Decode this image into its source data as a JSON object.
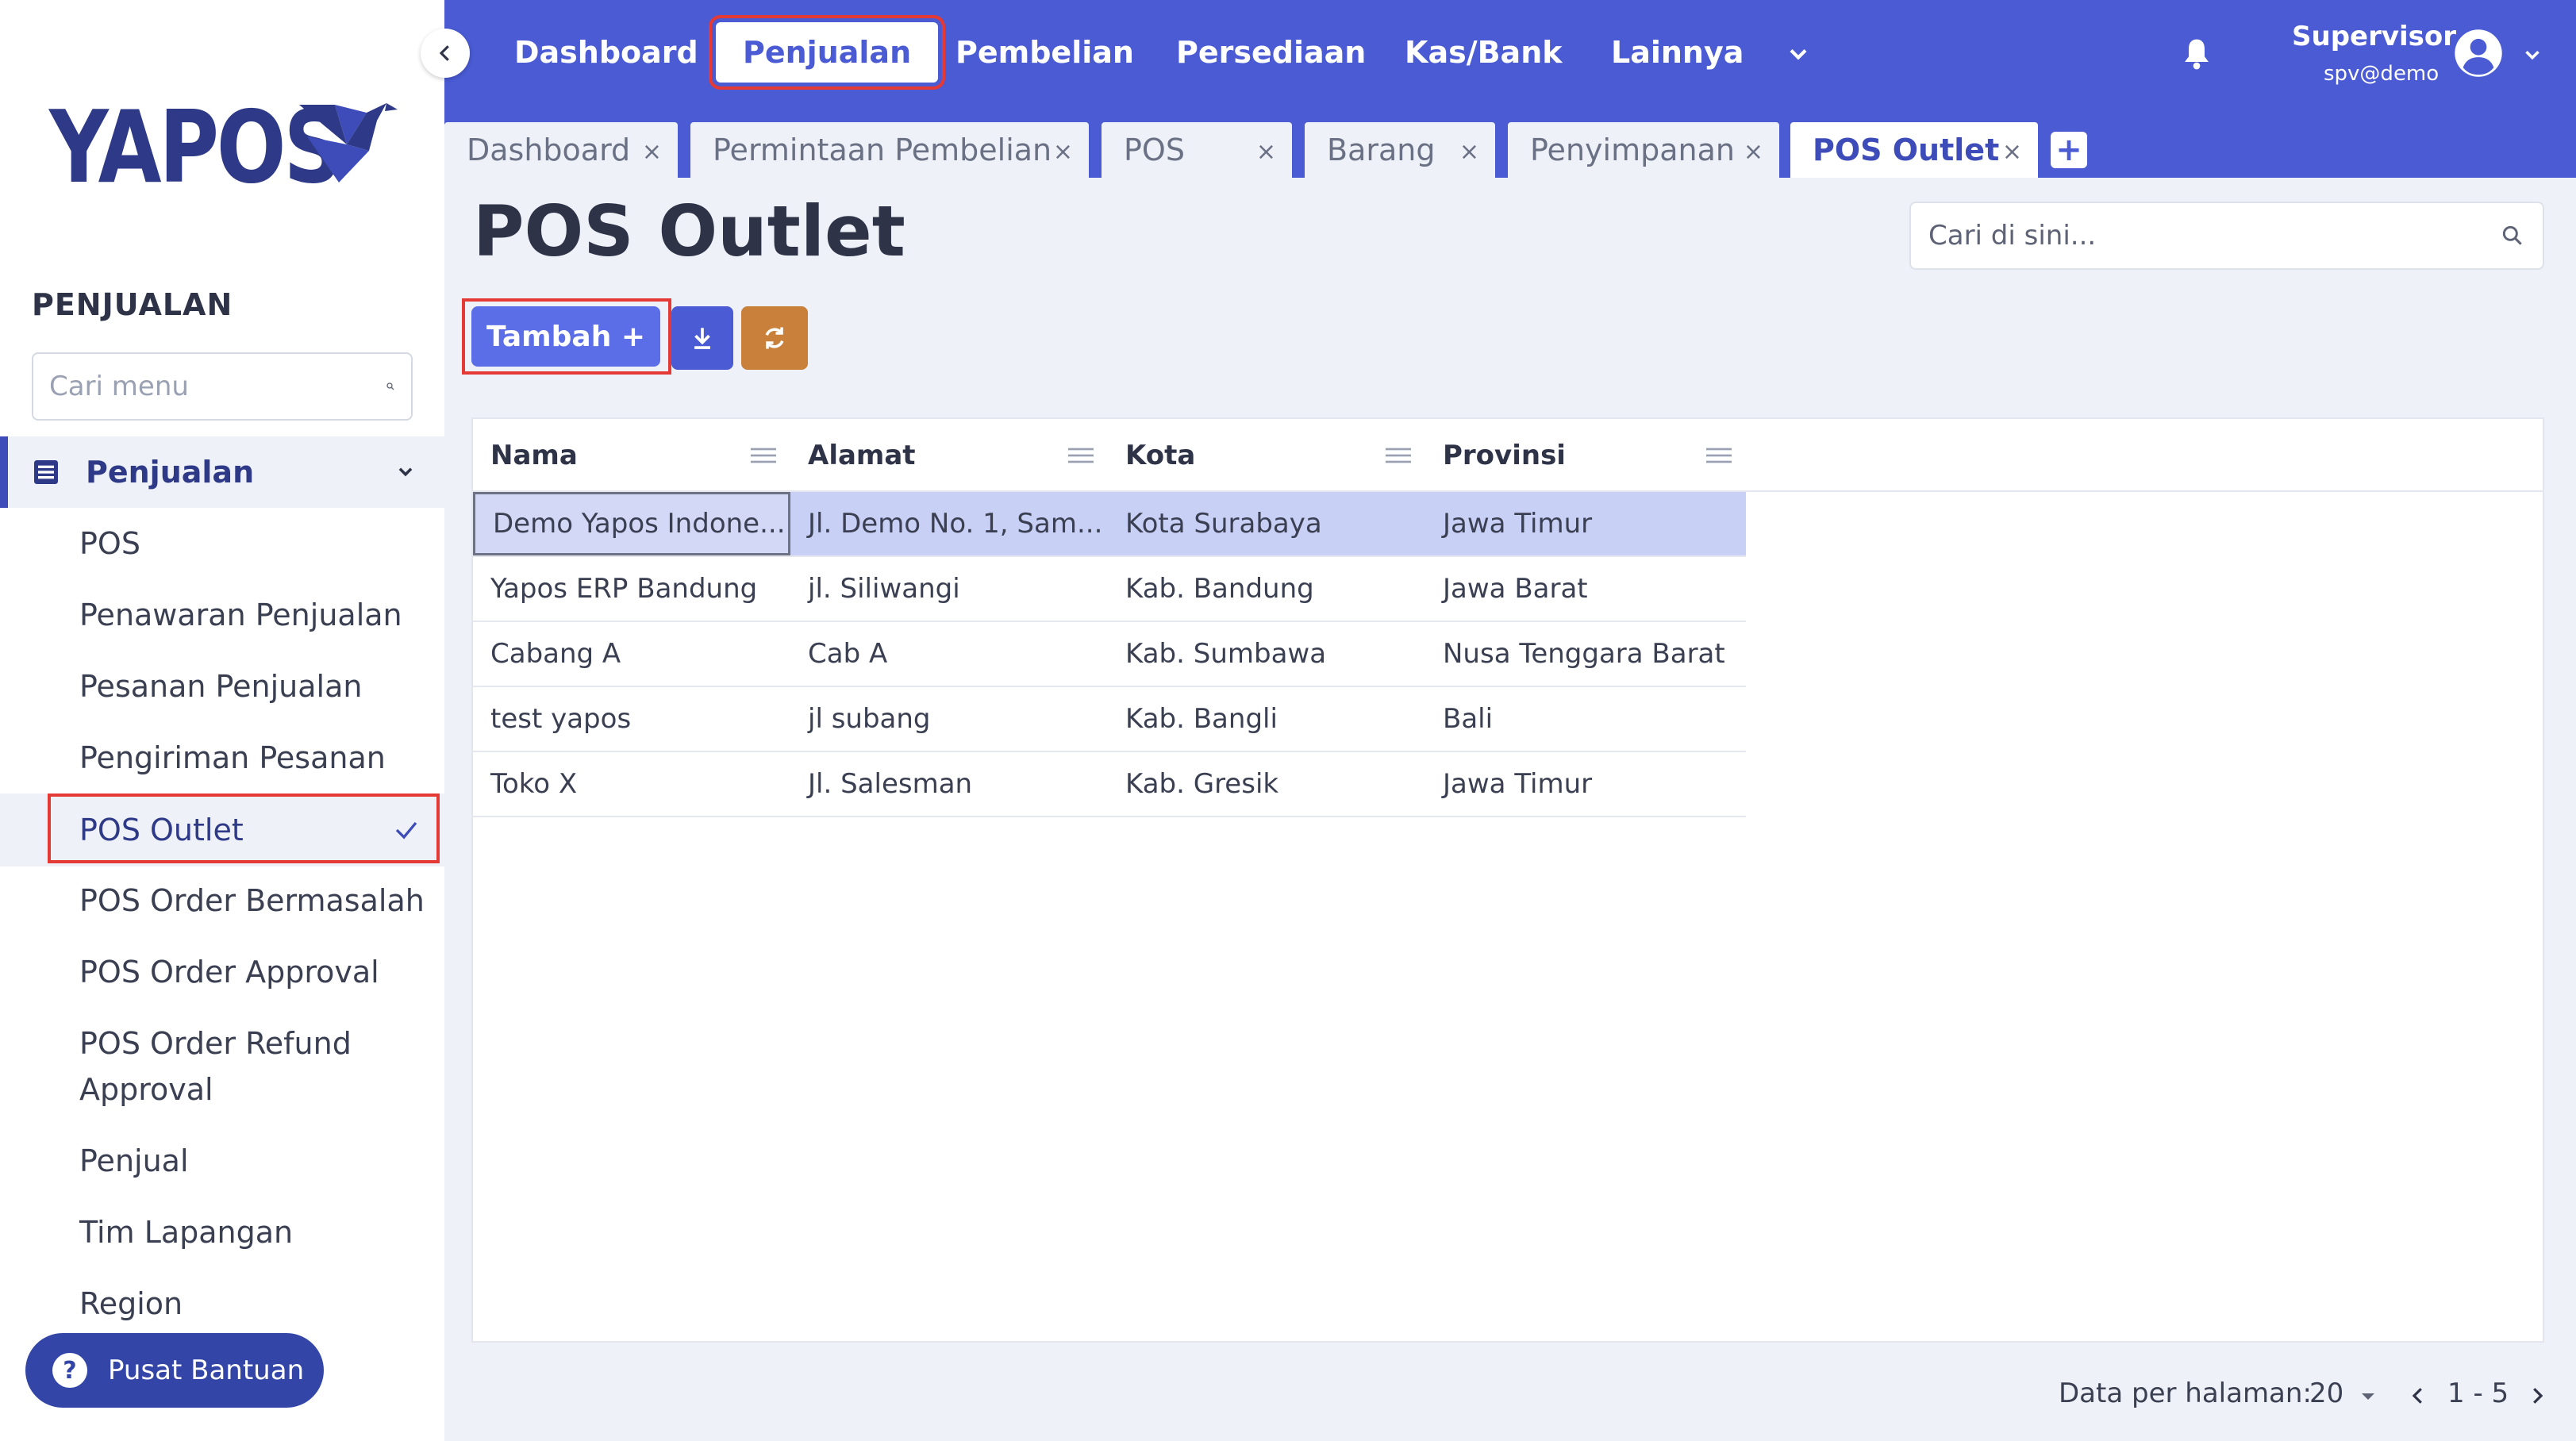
{
  "brand": {
    "name": "YAPOS"
  },
  "sidebar": {
    "section_title": "PENJUALAN",
    "search_placeholder": "Cari menu",
    "group": {
      "label": "Penjualan"
    },
    "items": [
      {
        "label": "POS"
      },
      {
        "label": "Penawaran Penjualan"
      },
      {
        "label": "Pesanan Penjualan"
      },
      {
        "label": "Pengiriman Pesanan"
      },
      {
        "label": "POS Outlet",
        "active": true
      },
      {
        "label": "POS Order Bermasalah"
      },
      {
        "label": "POS Order Approval"
      },
      {
        "label": "POS Order Refund Approval"
      },
      {
        "label": "Penjual"
      },
      {
        "label": "Tim Lapangan"
      },
      {
        "label": "Region"
      }
    ],
    "help_label": "Pusat Bantuan"
  },
  "topnav": {
    "items": [
      {
        "label": "Dashboard"
      },
      {
        "label": "Penjualan",
        "active": true
      },
      {
        "label": "Pembelian"
      },
      {
        "label": "Persediaan"
      },
      {
        "label": "Kas/Bank"
      },
      {
        "label": "Lainnya"
      }
    ],
    "user": {
      "name": "Supervisor",
      "email": "spv@demo"
    }
  },
  "tabs": [
    {
      "label": "Dashboard"
    },
    {
      "label": "Permintaan Pembelian"
    },
    {
      "label": "POS"
    },
    {
      "label": "Barang"
    },
    {
      "label": "Penyimpanan"
    },
    {
      "label": "POS Outlet",
      "active": true
    }
  ],
  "page": {
    "title": "POS Outlet",
    "search_placeholder": "Cari di sini...",
    "add_label": "Tambah +"
  },
  "table": {
    "columns": [
      "Nama",
      "Alamat",
      "Kota",
      "Provinsi"
    ],
    "rows": [
      [
        "Demo Yapos Indone...",
        "Jl. Demo No. 1, Sam...",
        "Kota Surabaya",
        "Jawa Timur"
      ],
      [
        "Yapos ERP Bandung",
        "jl. Siliwangi",
        "Kab. Bandung",
        "Jawa Barat"
      ],
      [
        "Cabang A",
        "Cab A",
        "Kab. Sumbawa",
        "Nusa Tenggara Barat"
      ],
      [
        "test yapos",
        "jl subang",
        "Kab. Bangli",
        "Bali"
      ],
      [
        "Toko X",
        "Jl. Salesman",
        "Kab. Gresik",
        "Jawa Timur"
      ]
    ]
  },
  "pagination": {
    "label": "Data per halaman:",
    "page_size": "20",
    "range": "1 - 5"
  },
  "colors": {
    "primary": "#4a5bd4",
    "brand_dark": "#2e3a87",
    "highlight": "#e53935",
    "sync_button": "#c8803a",
    "selected_row": "#c9d0f5"
  }
}
